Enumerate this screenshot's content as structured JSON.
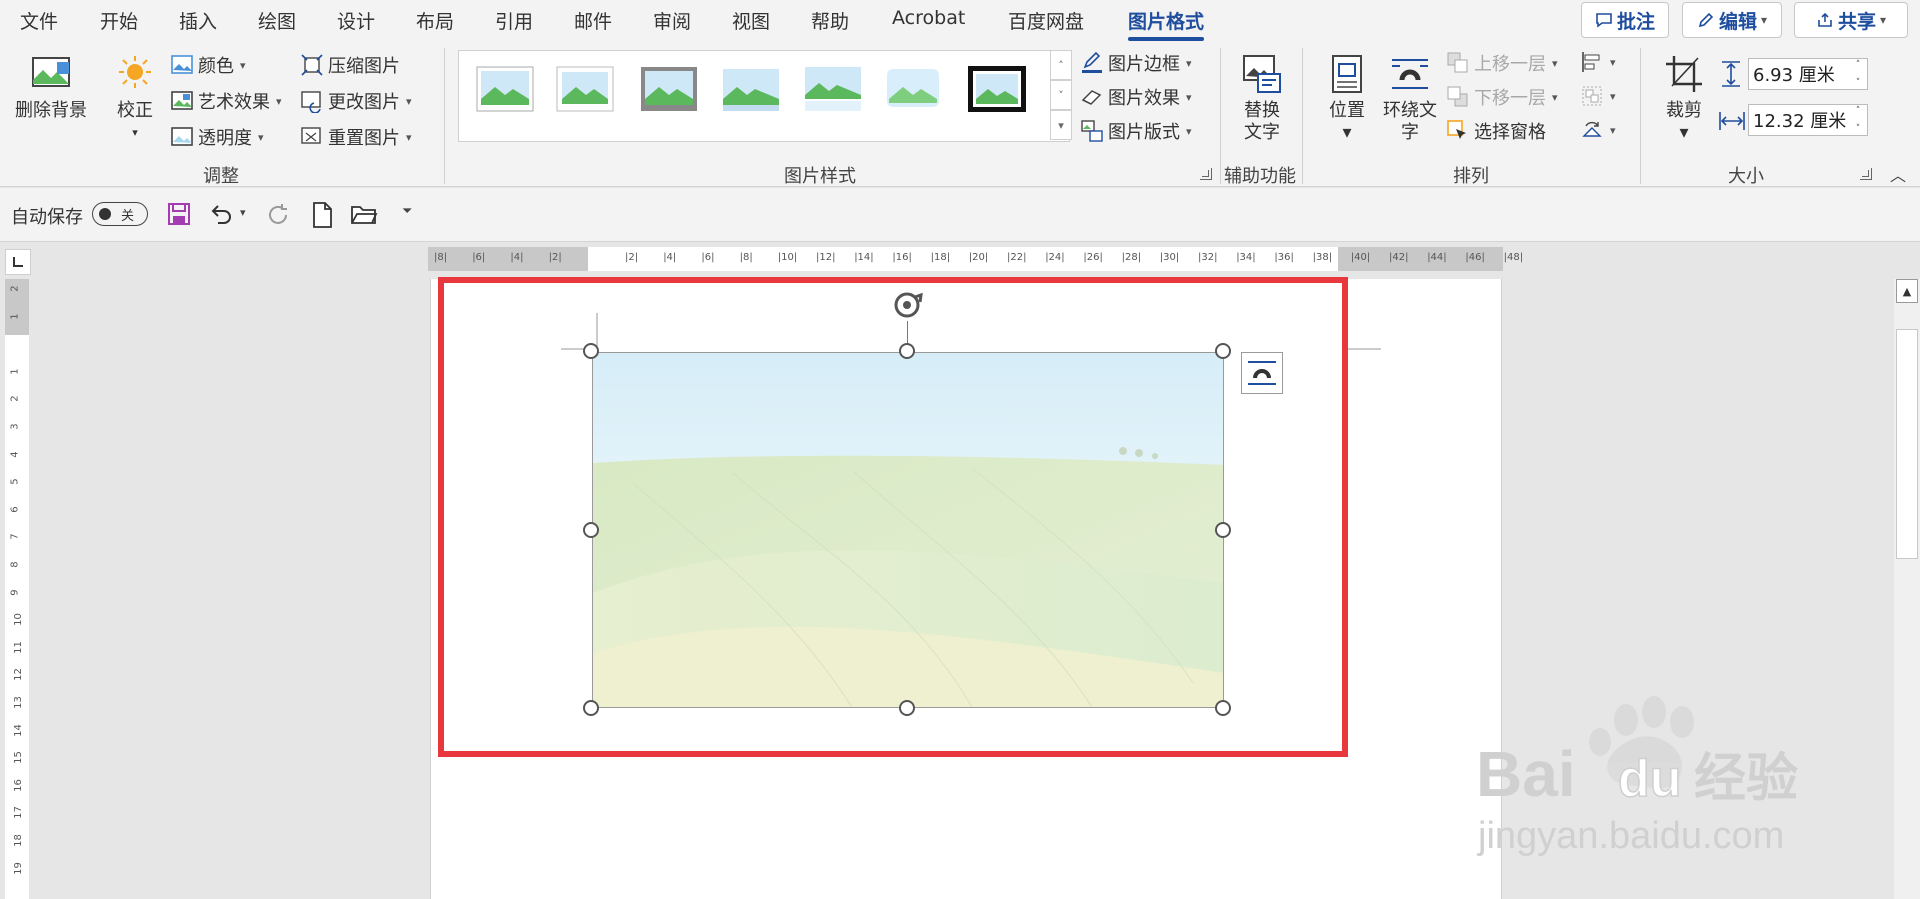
{
  "tabs": [
    "文件",
    "开始",
    "插入",
    "绘图",
    "设计",
    "布局",
    "引用",
    "邮件",
    "审阅",
    "视图",
    "帮助",
    "Acrobat",
    "百度网盘",
    "图片格式"
  ],
  "active_tab": "图片格式",
  "top_actions": {
    "comment": "批注",
    "edit": "编辑",
    "share": "共享"
  },
  "ribbon": {
    "adjust": {
      "remove_bg": "删除背景",
      "correct": "校正",
      "color": "颜色",
      "artistic": "艺术效果",
      "transparency": "透明度",
      "compress": "压缩图片",
      "change": "更改图片",
      "reset": "重置图片",
      "label": "调整"
    },
    "styles": {
      "border": "图片边框",
      "effect": "图片效果",
      "layout": "图片版式",
      "label": "图片样式"
    },
    "accessibility": {
      "alt_line1": "替换",
      "alt_line2": "文字",
      "label": "辅助功能"
    },
    "arrange": {
      "position": "位置",
      "wrap_line1": "环绕文",
      "wrap_line2": "字",
      "forward": "上移一层",
      "backward": "下移一层",
      "selection": "选择窗格",
      "label": "排列"
    },
    "size": {
      "crop": "裁剪",
      "height": "6.93 厘米",
      "width": "12.32 厘米",
      "label": "大小"
    }
  },
  "qat": {
    "autosave": "自动保存",
    "toggle_state": "关"
  },
  "hruler_labels": [
    "8",
    "6",
    "4",
    "2",
    "",
    "2",
    "4",
    "6",
    "8",
    "10",
    "12",
    "14",
    "16",
    "18",
    "20",
    "22",
    "24",
    "26",
    "28",
    "30",
    "32",
    "34",
    "36",
    "38",
    "40",
    "42",
    "44",
    "46",
    "48"
  ],
  "vruler_labels": [
    "2",
    "1",
    "",
    "1",
    "2",
    "3",
    "4",
    "5",
    "6",
    "7",
    "8",
    "9",
    "10",
    "11",
    "12",
    "13",
    "14",
    "15",
    "16",
    "17",
    "18",
    "19"
  ],
  "watermark": {
    "brand": "Bai",
    "brand2": "du",
    "cn": "经验",
    "url": "jingyan.baidu.com"
  },
  "colors": {
    "accent": "#1f4e9e",
    "highlight": "#e8383d"
  }
}
